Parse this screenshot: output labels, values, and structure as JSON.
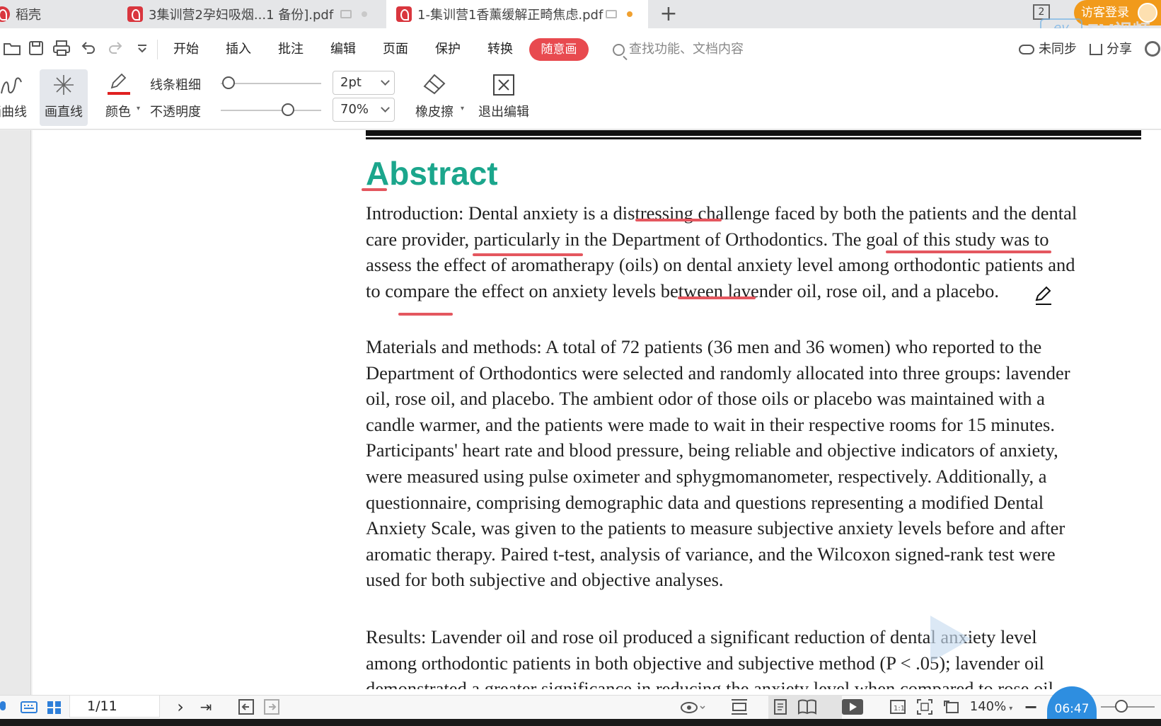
{
  "tabs": [
    {
      "label": "稻壳",
      "active": false
    },
    {
      "label": "3集训营2孕妇吸烟...1 备份].pdf",
      "active": false
    },
    {
      "label": "1-集训营1香薰缓解正畸焦虑.pdf",
      "active": true
    }
  ],
  "window_count": "2",
  "login_label": "访客登录",
  "watermark": "EV视频",
  "menu": {
    "items": [
      "开始",
      "插入",
      "批注",
      "编辑",
      "页面",
      "保护",
      "转换"
    ],
    "active": "随意画",
    "search_placeholder": "查找功能、文档内容",
    "sync_label": "未同步",
    "share_label": "分享"
  },
  "drawtools": {
    "curve_label": "画曲线",
    "line_label": "画直线",
    "color_label": "颜色",
    "thickness_label": "线条粗细",
    "opacity_label": "不透明度",
    "thickness_value": "2pt",
    "opacity_value": "70%",
    "eraser_label": "橡皮擦",
    "exit_label": "退出编辑"
  },
  "colors": {
    "accent": "#e84a4f",
    "title": "#1ba68c",
    "ink": "#e4575f",
    "login": "#f19a1b"
  },
  "document": {
    "heading": "Abstract",
    "intro": [
      "Introduction: Dental anxiety is a distressing challenge faced by both the patients and the dental",
      "care provider, particularly in the Department of Orthodontics. The goal of this study was to",
      "assess the effect of aromatherapy (oils) on dental anxiety level among orthodontic patients and",
      "to compare the effect on anxiety levels between lavender oil, rose oil, and a placebo."
    ],
    "methods": [
      "Materials and methods: A total of 72 patients (36 men and 36 women) who reported to the",
      "Department of Orthodontics were selected and randomly allocated into three groups: lavender",
      "oil, rose oil, and placebo. The ambient odor of those oils or placebo was maintained with a",
      "candle warmer, and the patients were made to wait in their respective rooms for 15 minutes.",
      "Participants' heart rate and blood pressure, being reliable and objective indicators of anxiety,",
      "were measured using pulse oximeter and sphygmomanometer, respectively. Additionally, a",
      "questionnaire, comprising demographic data and questions representing a modified Dental",
      "Anxiety Scale, was given to the patients to measure subjective anxiety levels before and after",
      "aromatic therapy. Paired t-test, analysis of variance, and the Wilcoxon signed-rank test were",
      "used for both subjective and objective analyses."
    ],
    "results": [
      "Results: Lavender oil and rose oil produced a significant reduction of dental anxiety level",
      "among orthodontic patients in both objective and subjective method (P < .05); lavender oil",
      "demonstrated a greater significance in reducing the anxiety level when compared to rose oil"
    ]
  },
  "status": {
    "page": "1/11",
    "zoom": "140%",
    "timer": "06:47"
  }
}
